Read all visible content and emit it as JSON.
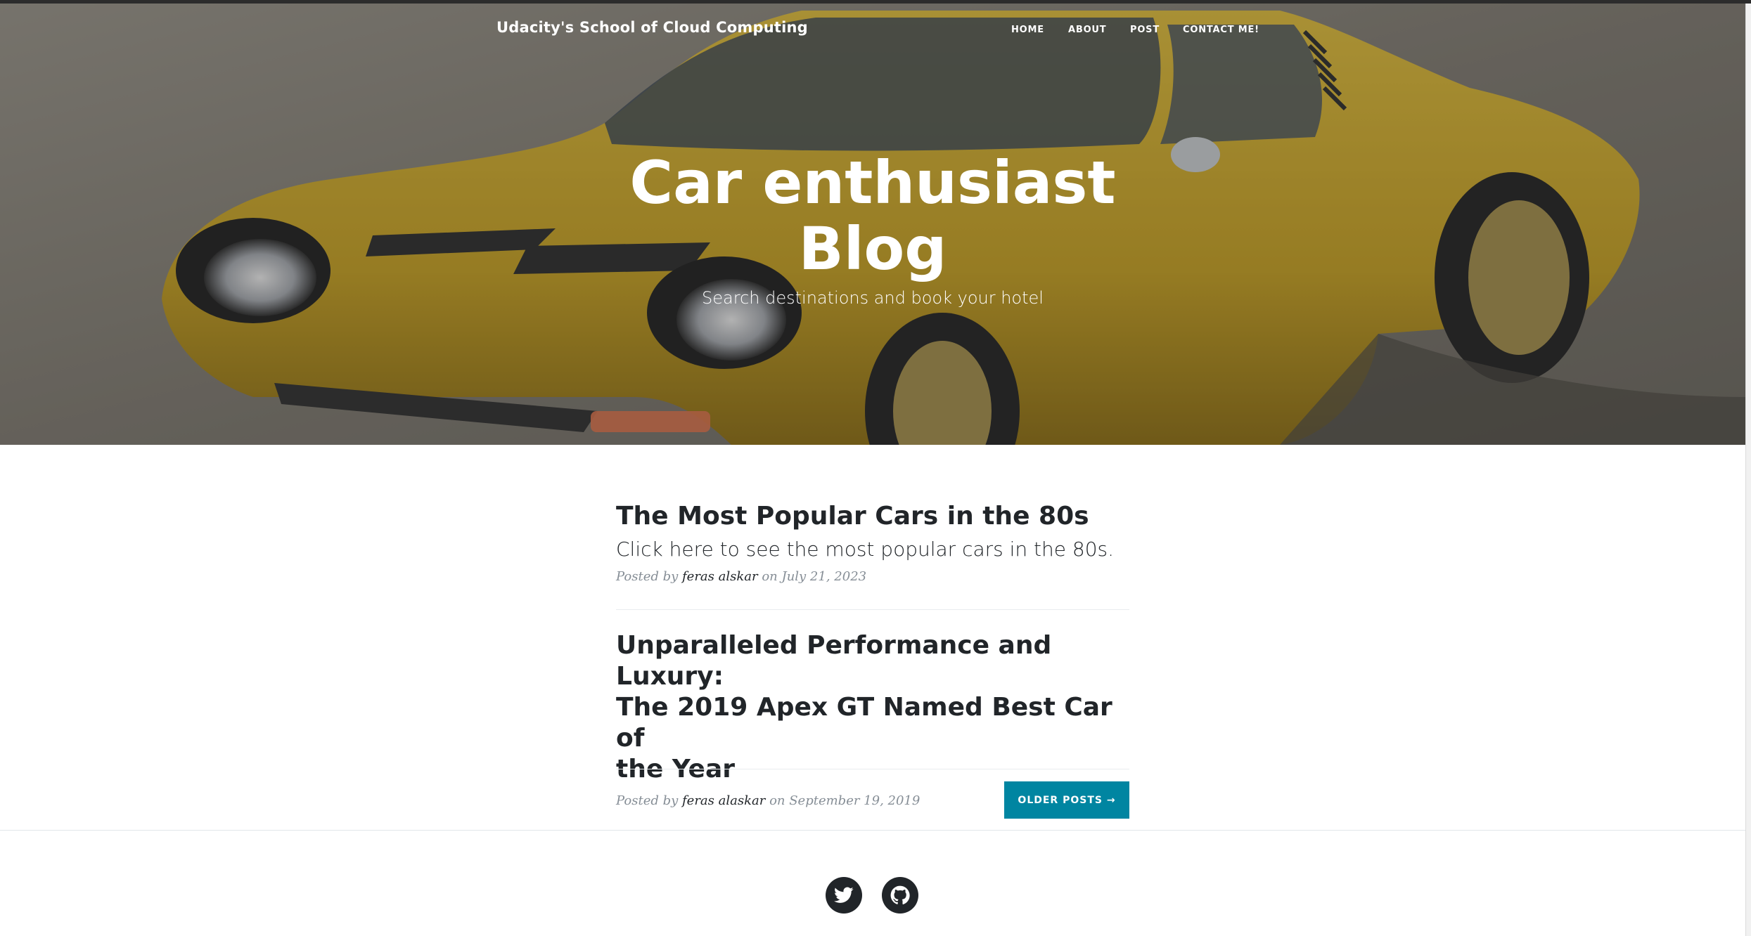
{
  "header": {
    "brand": "Udacity's School of Cloud Computing",
    "nav": [
      {
        "label": "HOME"
      },
      {
        "label": "ABOUT"
      },
      {
        "label": "POST"
      },
      {
        "label": "CONTACT ME!"
      }
    ]
  },
  "hero": {
    "title_line1": "Car enthusiast",
    "title_line2": "Blog",
    "subtitle": "Search destinations and book your hotel"
  },
  "posts": [
    {
      "title": "The Most Popular Cars in the 80s",
      "subtitle": "Click here to see the most popular cars in the 80s.",
      "meta_prefix": "Posted by",
      "author": "feras alskar",
      "meta_on": "on July 21, 2023"
    },
    {
      "title_line1": "Unparalleled Performance and Luxury:",
      "title_line2": "The 2019 Apex GT Named Best Car of",
      "title_line3": "the Year",
      "meta_prefix": "Posted by",
      "author": "feras alaskar",
      "meta_on": "on September 19, 2019"
    }
  ],
  "pager": {
    "older_label": "OLDER POSTS →"
  },
  "footer": {
    "social": [
      {
        "icon": "twitter-icon"
      },
      {
        "icon": "github-icon"
      }
    ]
  },
  "colors": {
    "accent": "#0085a1",
    "text": "#212529",
    "muted": "#868e96",
    "car_yellow": "#d9b22a"
  }
}
